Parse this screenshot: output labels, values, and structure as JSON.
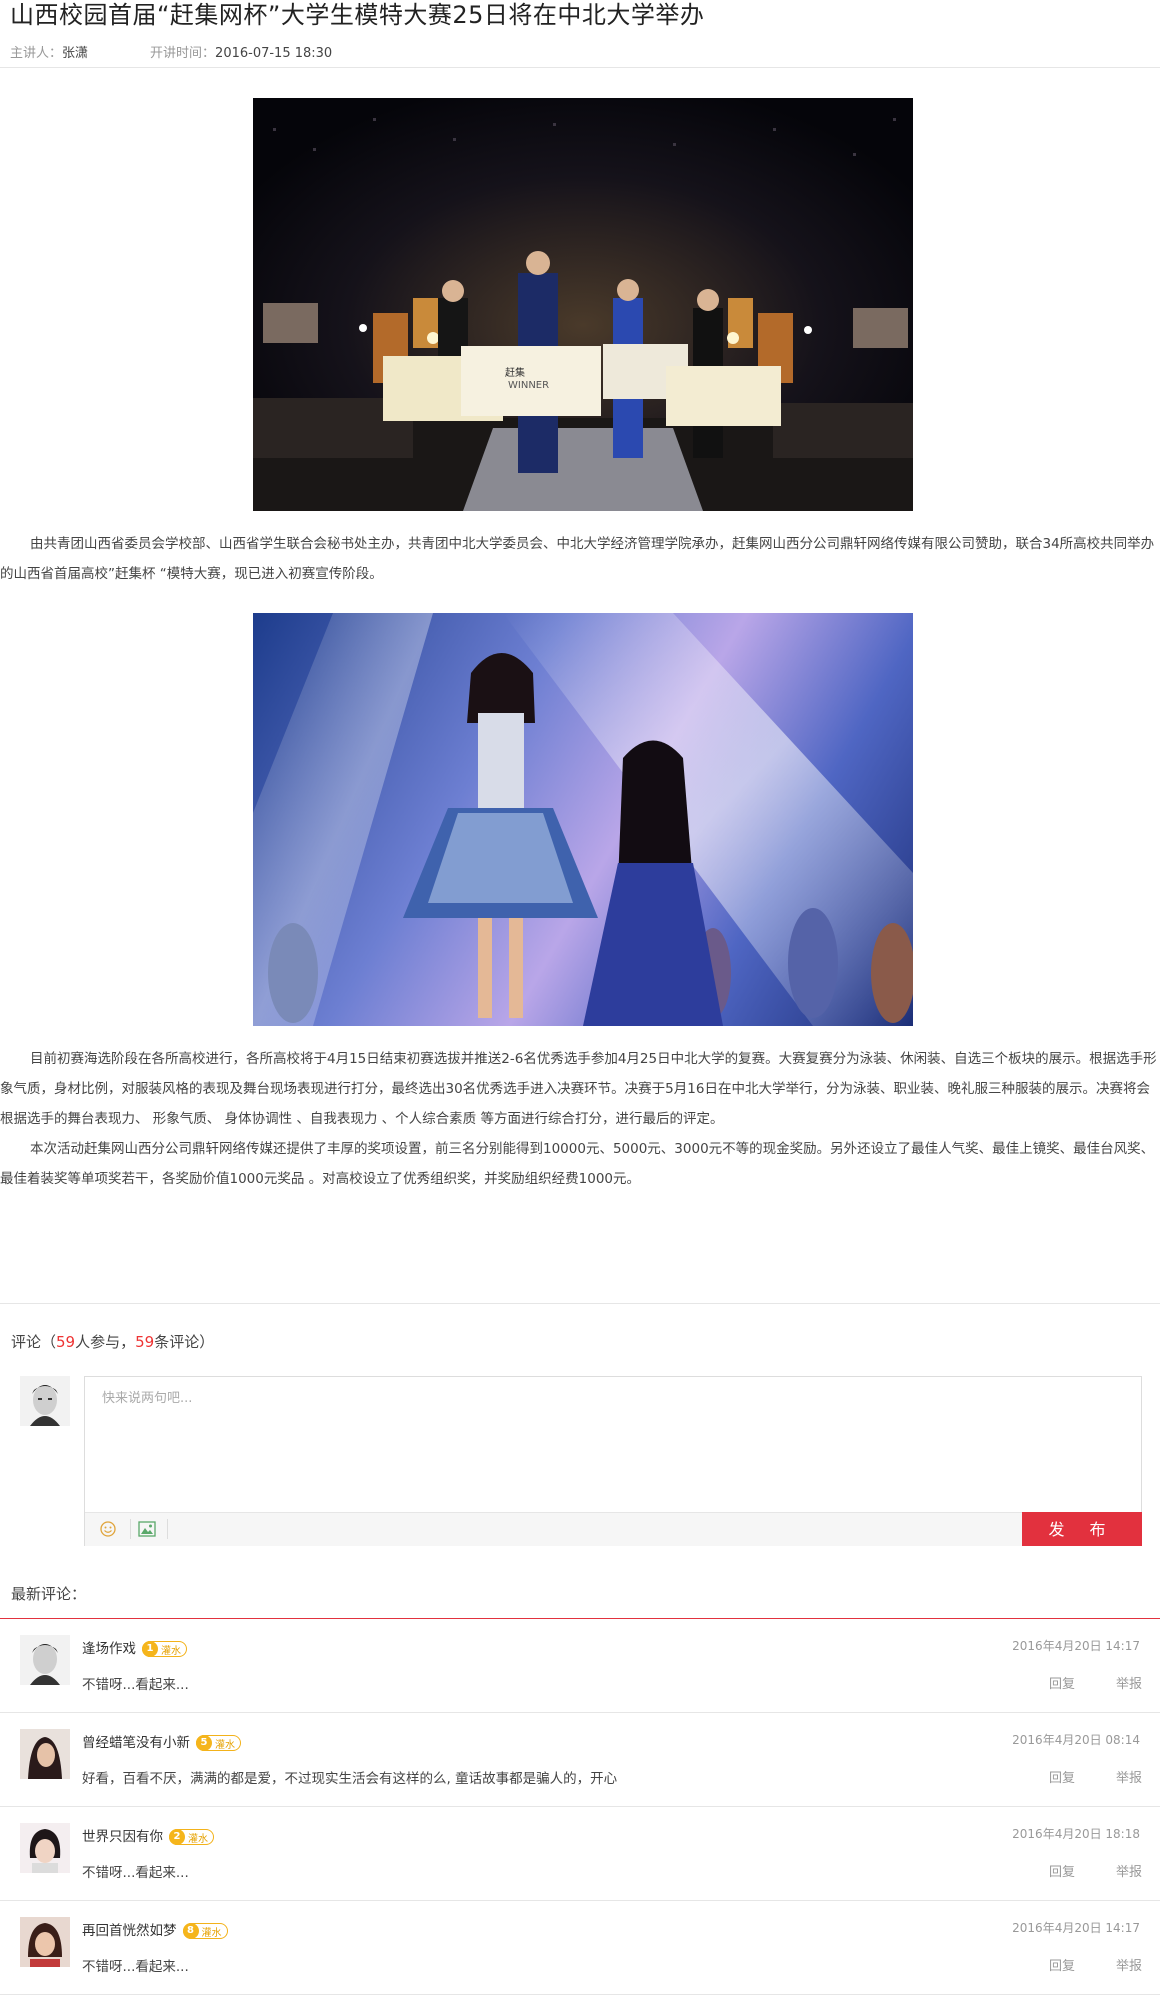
{
  "article": {
    "title": "山西校园首届“赶集网杯”大学生模特大赛25日将在中北大学举办",
    "speaker_label": "主讲人：",
    "speaker": "张潇",
    "time_label": "开讲时间：",
    "time": "2016-07-15  18:30",
    "photo1_texts": {
      "winner": "WINNER",
      "brand": "赶集"
    },
    "paragraph1": "由共青团山西省委员会学校部、山西省学生联合会秘书处主办，共青团中北大学委员会、中北大学经济管理学院承办，赶集网山西分公司鼎轩网络传媒有限公司赞助，联合34所高校共同举办的山西省首届高校”赶集杯 “模特大赛，现已进入初赛宣传阶段。",
    "paragraph2": "目前初赛海选阶段在各所高校进行，各所高校将于4月15日结束初赛选拔并推送2-6名优秀选手参加4月25日中北大学的复赛。大赛复赛分为泳装、休闲装、自选三个板块的展示。根据选手形象气质，身材比例，对服装风格的表现及舞台现场表现进行打分，最终选出30名优秀选手进入决赛环节。决赛于5月16日在中北大学举行，分为泳装、职业装、晚礼服三种服装的展示。决赛将会根据选手的舞台表现力、 形象气质、 身体协调性 、自我表现力 、个人综合素质 等方面进行综合打分，进行最后的评定。",
    "paragraph3": "本次活动赶集网山西分公司鼎轩网络传媒还提供了丰厚的奖项设置，前三名分别能得到10000元、5000元、3000元不等的现金奖励。另外还设立了最佳人气奖、最佳上镜奖、最佳台风奖、最佳着装奖等单项奖若干，各奖励价值1000元奖品 。对高校设立了优秀组织奖，并奖励组织经费1000元。"
  },
  "comments": {
    "header_prefix": "评论（",
    "participants": "59",
    "participants_suffix": "人参与，",
    "count": "59",
    "count_suffix": "条评论）",
    "input_placeholder": "快来说两句吧...",
    "publish_label": "发 布",
    "latest_label": "最新评论：",
    "badge_text": "灌水",
    "reply_label": "回复",
    "report_label": "举报",
    "accent_color": "#e2313e",
    "items": [
      {
        "name": "逢场作戏",
        "level": "1",
        "time": "2016年4月20日 14:17",
        "text": "不错呀...看起来..."
      },
      {
        "name": "曾经蜡笔没有小新",
        "level": "5",
        "time": "2016年4月20日 08:14",
        "text": "好看，百看不厌，满满的都是爱，不过现实生活会有这样的么, 童话故事都是骗人的，开心"
      },
      {
        "name": "世界只因有你",
        "level": "2",
        "time": "2016年4月20日 18:18",
        "text": "不错呀...看起来..."
      },
      {
        "name": "再回首恍然如梦",
        "level": "8",
        "time": "2016年4月20日 14:17",
        "text": "不错呀...看起来..."
      }
    ]
  }
}
